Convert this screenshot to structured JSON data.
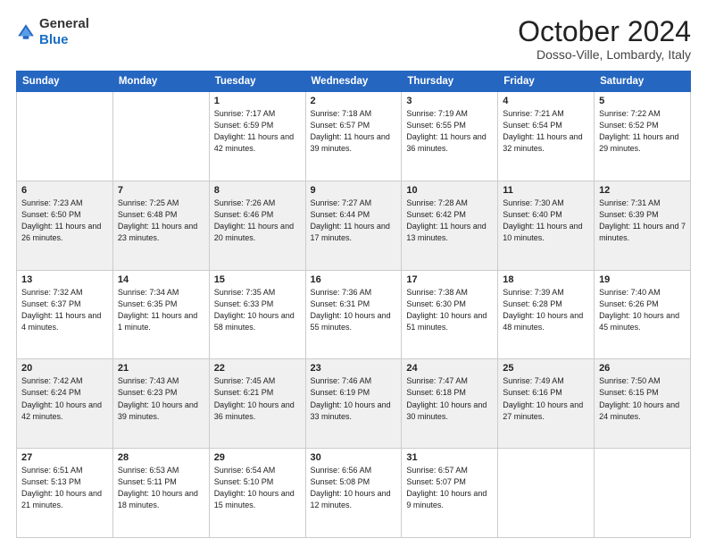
{
  "logo": {
    "general": "General",
    "blue": "Blue"
  },
  "header": {
    "month": "October 2024",
    "location": "Dosso-Ville, Lombardy, Italy"
  },
  "days_of_week": [
    "Sunday",
    "Monday",
    "Tuesday",
    "Wednesday",
    "Thursday",
    "Friday",
    "Saturday"
  ],
  "weeks": [
    [
      {
        "day": "",
        "sunrise": "",
        "sunset": "",
        "daylight": ""
      },
      {
        "day": "",
        "sunrise": "",
        "sunset": "",
        "daylight": ""
      },
      {
        "day": "1",
        "sunrise": "Sunrise: 7:17 AM",
        "sunset": "Sunset: 6:59 PM",
        "daylight": "Daylight: 11 hours and 42 minutes."
      },
      {
        "day": "2",
        "sunrise": "Sunrise: 7:18 AM",
        "sunset": "Sunset: 6:57 PM",
        "daylight": "Daylight: 11 hours and 39 minutes."
      },
      {
        "day": "3",
        "sunrise": "Sunrise: 7:19 AM",
        "sunset": "Sunset: 6:55 PM",
        "daylight": "Daylight: 11 hours and 36 minutes."
      },
      {
        "day": "4",
        "sunrise": "Sunrise: 7:21 AM",
        "sunset": "Sunset: 6:54 PM",
        "daylight": "Daylight: 11 hours and 32 minutes."
      },
      {
        "day": "5",
        "sunrise": "Sunrise: 7:22 AM",
        "sunset": "Sunset: 6:52 PM",
        "daylight": "Daylight: 11 hours and 29 minutes."
      }
    ],
    [
      {
        "day": "6",
        "sunrise": "Sunrise: 7:23 AM",
        "sunset": "Sunset: 6:50 PM",
        "daylight": "Daylight: 11 hours and 26 minutes."
      },
      {
        "day": "7",
        "sunrise": "Sunrise: 7:25 AM",
        "sunset": "Sunset: 6:48 PM",
        "daylight": "Daylight: 11 hours and 23 minutes."
      },
      {
        "day": "8",
        "sunrise": "Sunrise: 7:26 AM",
        "sunset": "Sunset: 6:46 PM",
        "daylight": "Daylight: 11 hours and 20 minutes."
      },
      {
        "day": "9",
        "sunrise": "Sunrise: 7:27 AM",
        "sunset": "Sunset: 6:44 PM",
        "daylight": "Daylight: 11 hours and 17 minutes."
      },
      {
        "day": "10",
        "sunrise": "Sunrise: 7:28 AM",
        "sunset": "Sunset: 6:42 PM",
        "daylight": "Daylight: 11 hours and 13 minutes."
      },
      {
        "day": "11",
        "sunrise": "Sunrise: 7:30 AM",
        "sunset": "Sunset: 6:40 PM",
        "daylight": "Daylight: 11 hours and 10 minutes."
      },
      {
        "day": "12",
        "sunrise": "Sunrise: 7:31 AM",
        "sunset": "Sunset: 6:39 PM",
        "daylight": "Daylight: 11 hours and 7 minutes."
      }
    ],
    [
      {
        "day": "13",
        "sunrise": "Sunrise: 7:32 AM",
        "sunset": "Sunset: 6:37 PM",
        "daylight": "Daylight: 11 hours and 4 minutes."
      },
      {
        "day": "14",
        "sunrise": "Sunrise: 7:34 AM",
        "sunset": "Sunset: 6:35 PM",
        "daylight": "Daylight: 11 hours and 1 minute."
      },
      {
        "day": "15",
        "sunrise": "Sunrise: 7:35 AM",
        "sunset": "Sunset: 6:33 PM",
        "daylight": "Daylight: 10 hours and 58 minutes."
      },
      {
        "day": "16",
        "sunrise": "Sunrise: 7:36 AM",
        "sunset": "Sunset: 6:31 PM",
        "daylight": "Daylight: 10 hours and 55 minutes."
      },
      {
        "day": "17",
        "sunrise": "Sunrise: 7:38 AM",
        "sunset": "Sunset: 6:30 PM",
        "daylight": "Daylight: 10 hours and 51 minutes."
      },
      {
        "day": "18",
        "sunrise": "Sunrise: 7:39 AM",
        "sunset": "Sunset: 6:28 PM",
        "daylight": "Daylight: 10 hours and 48 minutes."
      },
      {
        "day": "19",
        "sunrise": "Sunrise: 7:40 AM",
        "sunset": "Sunset: 6:26 PM",
        "daylight": "Daylight: 10 hours and 45 minutes."
      }
    ],
    [
      {
        "day": "20",
        "sunrise": "Sunrise: 7:42 AM",
        "sunset": "Sunset: 6:24 PM",
        "daylight": "Daylight: 10 hours and 42 minutes."
      },
      {
        "day": "21",
        "sunrise": "Sunrise: 7:43 AM",
        "sunset": "Sunset: 6:23 PM",
        "daylight": "Daylight: 10 hours and 39 minutes."
      },
      {
        "day": "22",
        "sunrise": "Sunrise: 7:45 AM",
        "sunset": "Sunset: 6:21 PM",
        "daylight": "Daylight: 10 hours and 36 minutes."
      },
      {
        "day": "23",
        "sunrise": "Sunrise: 7:46 AM",
        "sunset": "Sunset: 6:19 PM",
        "daylight": "Daylight: 10 hours and 33 minutes."
      },
      {
        "day": "24",
        "sunrise": "Sunrise: 7:47 AM",
        "sunset": "Sunset: 6:18 PM",
        "daylight": "Daylight: 10 hours and 30 minutes."
      },
      {
        "day": "25",
        "sunrise": "Sunrise: 7:49 AM",
        "sunset": "Sunset: 6:16 PM",
        "daylight": "Daylight: 10 hours and 27 minutes."
      },
      {
        "day": "26",
        "sunrise": "Sunrise: 7:50 AM",
        "sunset": "Sunset: 6:15 PM",
        "daylight": "Daylight: 10 hours and 24 minutes."
      }
    ],
    [
      {
        "day": "27",
        "sunrise": "Sunrise: 6:51 AM",
        "sunset": "Sunset: 5:13 PM",
        "daylight": "Daylight: 10 hours and 21 minutes."
      },
      {
        "day": "28",
        "sunrise": "Sunrise: 6:53 AM",
        "sunset": "Sunset: 5:11 PM",
        "daylight": "Daylight: 10 hours and 18 minutes."
      },
      {
        "day": "29",
        "sunrise": "Sunrise: 6:54 AM",
        "sunset": "Sunset: 5:10 PM",
        "daylight": "Daylight: 10 hours and 15 minutes."
      },
      {
        "day": "30",
        "sunrise": "Sunrise: 6:56 AM",
        "sunset": "Sunset: 5:08 PM",
        "daylight": "Daylight: 10 hours and 12 minutes."
      },
      {
        "day": "31",
        "sunrise": "Sunrise: 6:57 AM",
        "sunset": "Sunset: 5:07 PM",
        "daylight": "Daylight: 10 hours and 9 minutes."
      },
      {
        "day": "",
        "sunrise": "",
        "sunset": "",
        "daylight": ""
      },
      {
        "day": "",
        "sunrise": "",
        "sunset": "",
        "daylight": ""
      }
    ]
  ]
}
